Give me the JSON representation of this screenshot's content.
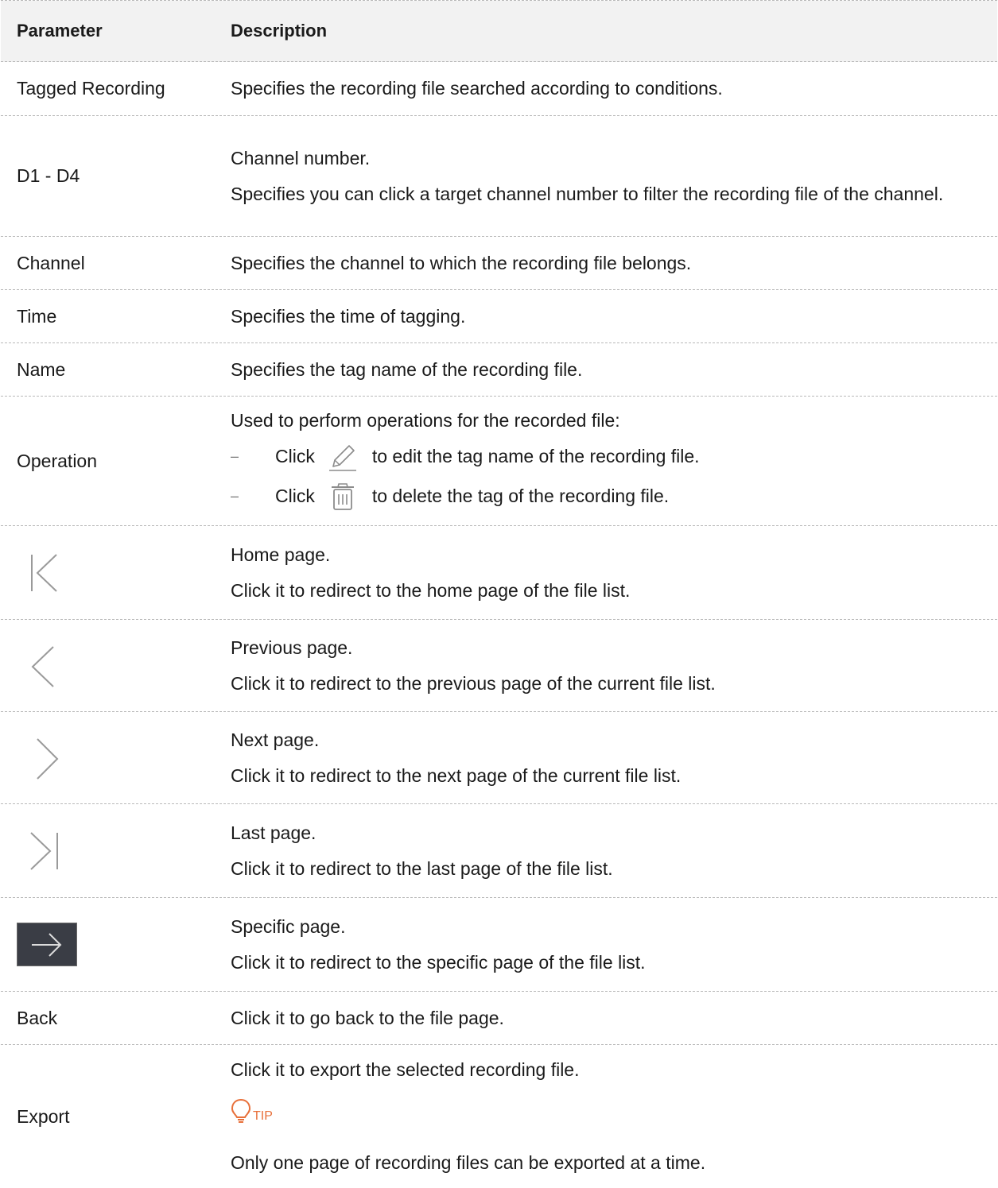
{
  "header": {
    "parameter": "Parameter",
    "description": "Description"
  },
  "rows": {
    "tagged": {
      "param": "Tagged Recording",
      "desc": "Specifies the recording file searched according to conditions."
    },
    "d1d4": {
      "param": "D1 - D4",
      "desc1": "Channel number.",
      "desc2": "Specifies you can click a target channel number to filter the recording file of the channel."
    },
    "channel": {
      "param": "Channel",
      "desc": "Specifies the channel to which the recording file belongs."
    },
    "time": {
      "param": "Time",
      "desc": "Specifies the time of tagging."
    },
    "name": {
      "param": "Name",
      "desc": "Specifies the tag name of the recording file."
    },
    "operation": {
      "param": "Operation",
      "desc": "Used to perform operations for the recorded file:",
      "bullet_dash": "–",
      "edit": {
        "click": "Click",
        "text": "to edit the tag name of the recording file.",
        "icon": "pencil-edit-icon"
      },
      "delete": {
        "click": "Click",
        "text": "to delete the tag of the recording file.",
        "icon": "trash-icon"
      }
    },
    "home": {
      "icon": "first-page-icon",
      "desc1": "Home page.",
      "desc2": "Click it to redirect to the home page of the file list."
    },
    "prev": {
      "icon": "previous-page-icon",
      "desc1": "Previous page.",
      "desc2": "Click it to redirect to the previous page of the current file list."
    },
    "next": {
      "icon": "next-page-icon",
      "desc1": "Next page.",
      "desc2": "Click it to redirect to the next page of the current file list."
    },
    "last": {
      "icon": "last-page-icon",
      "desc1": "Last page.",
      "desc2": "Click it to redirect to the last page of the file list."
    },
    "specific": {
      "icon": "go-to-page-arrow-icon",
      "desc1": "Specific page.",
      "desc2": "Click it to redirect to the specific page of the file list."
    },
    "back": {
      "param": "Back",
      "desc": "Click it to go back to the file page."
    },
    "export": {
      "param": "Export",
      "desc": "Click it to export the selected recording file.",
      "tip_label": "TIP",
      "tip_icon": "lightbulb-icon",
      "tip_text": "Only one page of recording files can be exported at a time."
    }
  },
  "colors": {
    "tip_accent": "#e8703a",
    "header_bg": "#f2f2f2",
    "button_bg": "#3a3d45",
    "divider": "#b9b9b9",
    "icon_gray": "#8c8c8c"
  }
}
